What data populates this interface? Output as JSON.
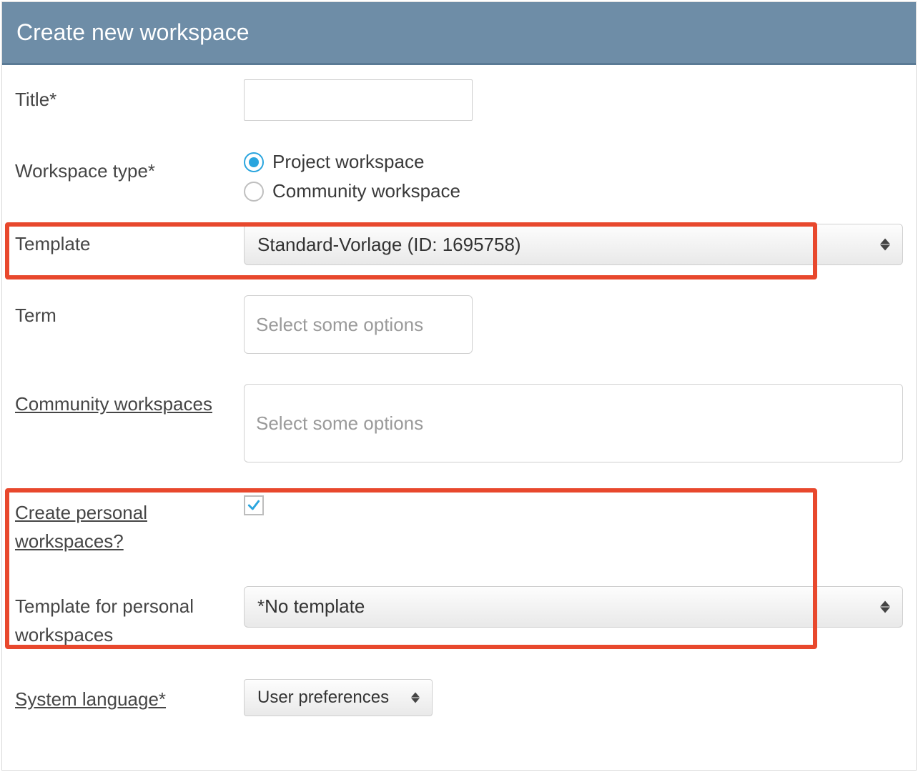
{
  "header": {
    "title": "Create new workspace"
  },
  "form": {
    "title": {
      "label": "Title*",
      "value": ""
    },
    "workspace_type": {
      "label": "Workspace type*",
      "options": {
        "project": "Project workspace",
        "community": "Community workspace"
      }
    },
    "template": {
      "label": "Template",
      "value": "Standard-Vorlage (ID: 1695758)"
    },
    "term": {
      "label": "Term",
      "placeholder": "Select some options"
    },
    "community_ws": {
      "label": "Community workspaces",
      "placeholder": "Select some options"
    },
    "create_personal": {
      "label": "Create personal workspaces?",
      "checked": true
    },
    "personal_tpl": {
      "label": "Template for personal workspaces",
      "value": "*No template"
    },
    "language": {
      "label": "System language*",
      "value": "User preferences"
    }
  }
}
